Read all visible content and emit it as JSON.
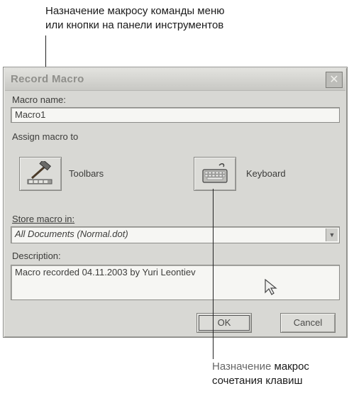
{
  "callouts": {
    "top_line1": "Назначение макросу команды меню",
    "top_line2": "или кнопки на панели инструментов",
    "bottom_line1_em": "Назначение",
    "bottom_line1_rest": " макрос",
    "bottom_line2": "сочетания клавиш"
  },
  "dialog": {
    "title": "Record Macro",
    "close_glyph": "✕",
    "macro_name_label": "Macro name:",
    "macro_name_value": "Macro1",
    "assign_label": "Assign macro to",
    "toolbars_label": "Toolbars",
    "keyboard_label": "Keyboard",
    "store_label": "Store macro in:",
    "store_value": "All Documents (Normal.dot)",
    "select_arrow": "▼",
    "description_label": "Description:",
    "description_value": "Macro recorded 04.11.2003 by Yuri Leontiev",
    "ok_label": "OK",
    "cancel_label": "Cancel"
  },
  "icons": {
    "toolbars": "hammer-toolbar-icon",
    "keyboard": "keyboard-icon",
    "close": "close-icon",
    "cursor": "mouse-pointer-icon"
  }
}
